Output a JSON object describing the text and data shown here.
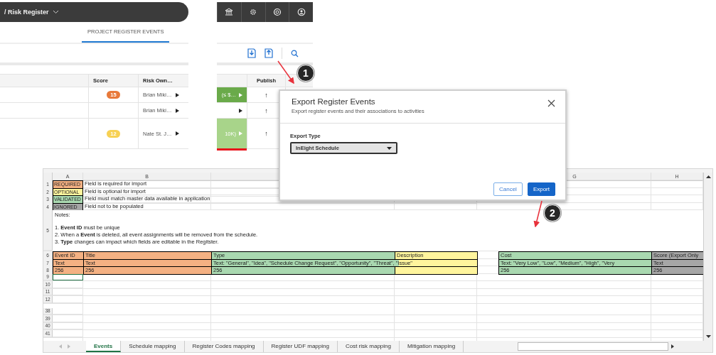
{
  "app": {
    "breadcrumb": "/ Risk Register",
    "tabs": [
      {
        "label": "PROJECT REGISTER EVENTS",
        "selected": true
      }
    ],
    "columns": [
      {
        "label": "Score"
      },
      {
        "label": "Risk Own…"
      },
      {
        "label": "Publish"
      }
    ],
    "rows": [
      {
        "score": {
          "text": "15",
          "color": "#e8793a"
        },
        "owner": "Brian Miki…",
        "cost": {
          "text": "(≤ $…",
          "color": "#6aaa4a"
        },
        "publish": "↑"
      },
      {
        "owner": "Brian Miki…",
        "cost": {
          "color": "#ffffff"
        },
        "publish": "↑"
      },
      {
        "score": {
          "text": "12",
          "color": "#f7d154"
        },
        "owner": "Nate St. J…",
        "cost": {
          "text": "10K)",
          "color": "#a8d48a"
        },
        "publish": "↑",
        "status": {
          "color": "#e8141c"
        }
      }
    ]
  },
  "dialog": {
    "title": "Export Register Events",
    "subtitle": "Export register events and their associations to activities",
    "field_label": "Export Type",
    "select_value": "InEight Schedule",
    "buttons": [
      {
        "label": "Cancel",
        "kind": "secondary"
      },
      {
        "label": "Export",
        "kind": "primary"
      }
    ]
  },
  "callouts": [
    {
      "label": "1"
    },
    {
      "label": "2"
    }
  ],
  "spreadsheet": {
    "column_letters": [
      "A",
      "B",
      "G",
      "H"
    ],
    "legend": [
      {
        "row": "1",
        "tag": "REQUIRED",
        "color": "#f4b183",
        "text": "Field is required for import"
      },
      {
        "row": "2",
        "tag": "OPTIONAL",
        "color": "#fff59d",
        "text": "Field is optional for import"
      },
      {
        "row": "3",
        "tag": "VALIDATED",
        "color": "#a9d8b0",
        "text": "Field must match master data available in application"
      },
      {
        "row": "4",
        "tag": "IGNORED",
        "color": "#a6a6a6",
        "text": "Field not to be populated"
      }
    ],
    "notes": {
      "row": "5",
      "heading": "Notes:",
      "lines": [
        "1. **Event ID** must be unique",
        "2.  When a **Event** is deleted, all event assignments will be removed from the schedule.",
        "3.  **Type** changes can impact which fields are editable in the Regitster."
      ]
    },
    "field_rows": [
      {
        "row": "6",
        "cells": [
          {
            "text": "Event ID",
            "color": "#f4b183"
          },
          {
            "text": "Title",
            "color": "#f4b183"
          },
          {
            "text": "Type",
            "color": "#a9d8b0"
          },
          {
            "text": "Description",
            "color": "#fff59d"
          },
          {
            "text": "Cost",
            "color": "#a9d8b0"
          },
          {
            "text": "Score (Export Only",
            "color": "#a6a6a6"
          }
        ]
      },
      {
        "row": "7",
        "cells": [
          {
            "text": "Text",
            "color": "#f4b183"
          },
          {
            "text": "Text",
            "color": "#f4b183"
          },
          {
            "text": "Text: \"General\", \"Idea\", \"Schedule Change Request\", \"Opportunity\", \"Threat\", \"Issue\"",
            "color": "#a9d8b0",
            "kind": "overflow"
          },
          {
            "color": "#fff59d"
          },
          {
            "text": "Text: \"Very Low\", \"Low\", \"Medium\", \"High\", \"Very",
            "color": "#a9d8b0"
          },
          {
            "text": "Text",
            "color": "#a6a6a6"
          }
        ]
      },
      {
        "row": "8",
        "cells": [
          {
            "text": "256",
            "color": "#f4b183"
          },
          {
            "text": "256",
            "color": "#f4b183"
          },
          {
            "text": "256",
            "color": "#a9d8b0"
          },
          {
            "color": "#fff59d"
          },
          {
            "text": "256",
            "color": "#a9d8b0"
          },
          {
            "text": "256",
            "color": "#a6a6a6"
          }
        ]
      }
    ],
    "empty_rows": [
      {
        "row": "9",
        "selected": true
      },
      {
        "row": "10",
        "selected": false
      },
      {
        "row": "11",
        "selected": false
      },
      {
        "row": "12",
        "selected": false
      },
      {
        "row": "38",
        "selected": false
      },
      {
        "row": "39",
        "selected": false
      },
      {
        "row": "40",
        "selected": false
      },
      {
        "row": "41",
        "selected": false
      }
    ],
    "sheet_tabs": [
      {
        "label": "Events",
        "selected": true
      },
      {
        "label": "Schedule mapping",
        "selected": false
      },
      {
        "label": "Register Codes mapping",
        "selected": false
      },
      {
        "label": "Register UDF mapping",
        "selected": false
      },
      {
        "label": "Cost risk mapping",
        "selected": false
      },
      {
        "label": "Mitigation mapping",
        "selected": false
      }
    ]
  }
}
